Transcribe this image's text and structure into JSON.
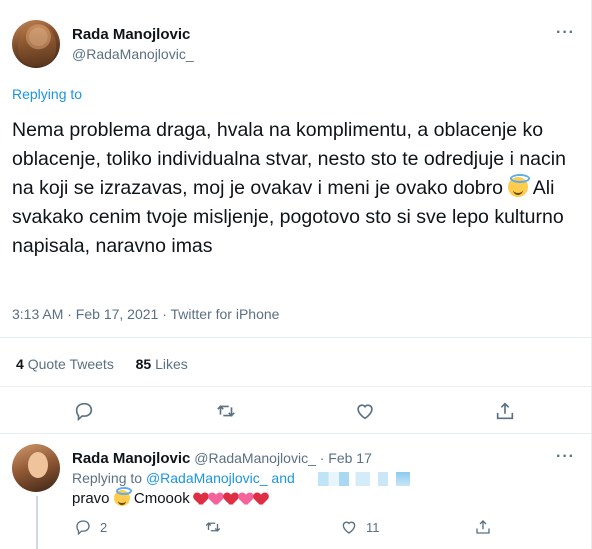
{
  "main_tweet": {
    "display_name": "Rada Manojlovic",
    "handle": "@RadaManojlovic_",
    "replying_label": "Replying to",
    "text": "Nema problema draga, hvala na komplimentu, a oblacenje ko oblacenje, toliko individualna stvar, nesto sto te odredjuje i nacin na koji se izrazavas, moj je ovakav i meni je ovako dobro",
    "text_tail": " Ali svakako cenim tvoje misljenje, pogotovo sto si sve lepo kulturno napisala, naravno imas",
    "emoji_icon": "smiling-face-with-halo",
    "timestamp": "3:13 AM · Feb 17, 2021 · Twitter for iPhone",
    "quote_count": "4",
    "quote_label": "Quote Tweets",
    "like_count": "85",
    "like_label": "Likes",
    "more_glyph": "···"
  },
  "reply_tweet": {
    "display_name": "Rada Manojlovic",
    "handle_time": "@RadaManojlovic_ · Feb 17",
    "replying_prefix": "Replying to",
    "replying_link": "@RadaManojlovic_ and",
    "text_start": "pravo",
    "text_mid": "Cmoook",
    "reply_count": "2",
    "like_count": "11",
    "more_glyph": "···"
  },
  "colors": {
    "link": "#1b95e0",
    "secondary": "#5b7083",
    "divider": "#e6ecf0"
  }
}
